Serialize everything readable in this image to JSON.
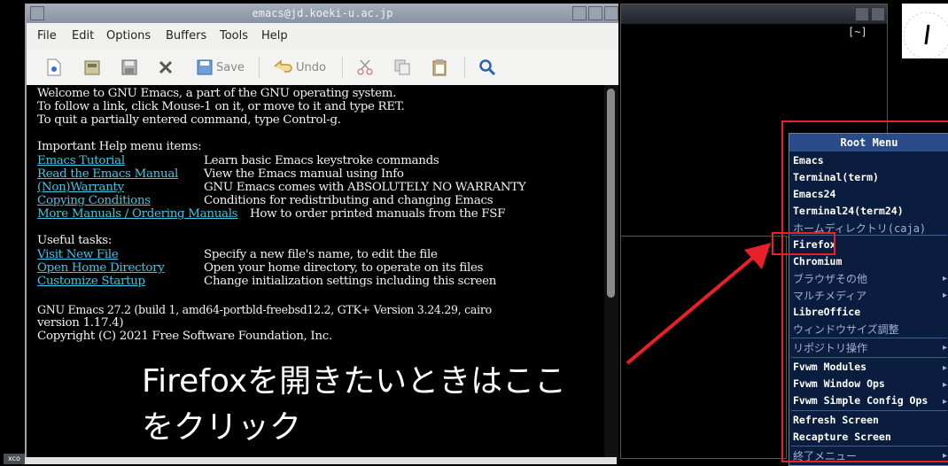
{
  "emacs": {
    "title": "emacs@jd.koeki-u.ac.jp",
    "menu": [
      "File",
      "Edit",
      "Options",
      "Buffers",
      "Tools",
      "Help"
    ],
    "toolbar": {
      "save_label": "Save",
      "undo_label": "Undo"
    },
    "buffer": {
      "welcome": [
        "Welcome to GNU Emacs, a part of the GNU operating system.",
        "To follow a link, click Mouse-1 on it, or move to it and type RET.",
        "To quit a partially entered command, type Control-g."
      ],
      "help_heading": "Important Help menu items:",
      "help_items": [
        {
          "link": "Emacs Tutorial",
          "desc": "Learn basic Emacs keystroke commands"
        },
        {
          "link": "Read the Emacs Manual",
          "desc": "View the Emacs manual using Info"
        },
        {
          "link": "(Non)Warranty",
          "desc": "GNU Emacs comes with ABSOLUTELY NO WARRANTY"
        },
        {
          "link": "Copying Conditions",
          "desc": "Conditions for redistributing and changing Emacs"
        },
        {
          "link": "More Manuals / Ordering Manuals",
          "desc": "How to order printed manuals from the FSF"
        }
      ],
      "tasks_heading": "Useful tasks:",
      "tasks": [
        {
          "link": "Visit New File",
          "desc": "Specify a new file's name, to edit the file"
        },
        {
          "link": "Open Home Directory",
          "desc": "Open your home directory, to operate on its files"
        },
        {
          "link": "Customize Startup",
          "desc": "Change initialization settings including this screen"
        }
      ],
      "version_line1": "GNU Emacs 27.2 (build 1, amd64-portbld-freebsd12.2, GTK+ Version 3.24.29, cairo",
      "version_line2": "version 1.17.4)",
      "copyright": "Copyright (C) 2021 Free Software Foundation, Inc."
    }
  },
  "terminal": {
    "label": "[~]"
  },
  "xcon_label": "xco",
  "root_menu": {
    "title": "Root Menu",
    "items": [
      "Emacs",
      "Terminal(term)",
      "Emacs24",
      "Terminal24(term24)",
      "ホームディレクトリ(caja)",
      "Firefox",
      "Chromium",
      "ブラウザその他",
      "マルチメディア",
      "LibreOffice",
      "ウィンドウサイズ調整",
      "リポジトリ操作",
      "Fvwm Modules",
      "Fvwm Window Ops",
      "Fvwm Simple Config Ops",
      "Refresh Screen",
      "Recapture Screen",
      "終了メニュー"
    ]
  },
  "caption": {
    "line1": "Firefoxを開きたいときはここ",
    "line2": "をクリック"
  },
  "colors": {
    "link": "#3cc8e6",
    "annotation_red": "#e8202a",
    "menu_bg": "#0a1d3e"
  }
}
